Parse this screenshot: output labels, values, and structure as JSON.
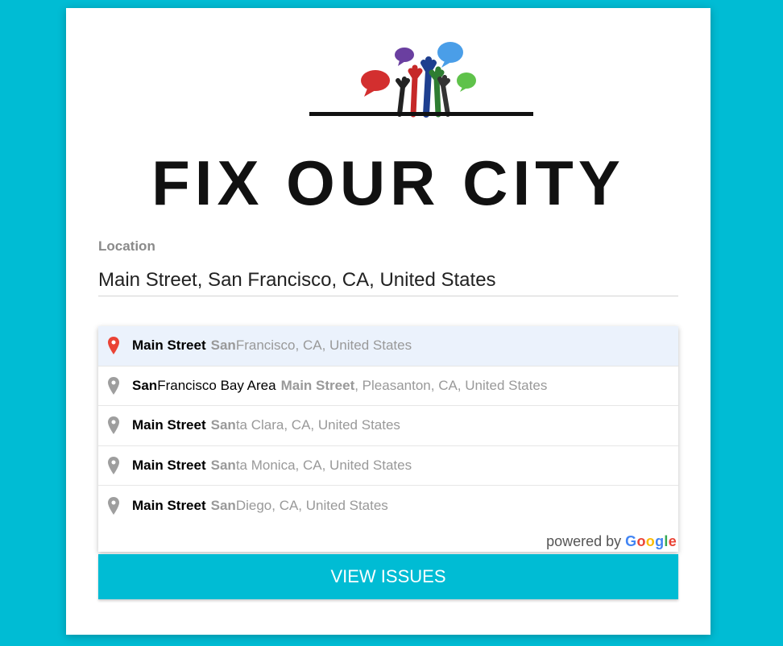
{
  "brand": {
    "title": "FIX OUR CITY",
    "logo_icon": "raised-hands-speech-bubbles-icon"
  },
  "location": {
    "label": "Location",
    "value": "Main Street, San Francisco, CA, United States"
  },
  "suggestions": [
    {
      "main": "Main Street",
      "main_rest": "",
      "secondary_bold": "San",
      "secondary": " Francisco, CA, United States",
      "icon": "map-pin-red-icon"
    },
    {
      "main": "San",
      "main_rest": " Francisco Bay Area",
      "secondary_bold": "Main Street",
      "secondary": ", Pleasanton, CA, United States",
      "icon": "map-pin-gray-icon"
    },
    {
      "main": "Main Street",
      "main_rest": "",
      "secondary_bold": "San",
      "secondary": "ta Clara, CA, United States",
      "icon": "map-pin-gray-icon"
    },
    {
      "main": "Main Street",
      "main_rest": "",
      "secondary_bold": "San",
      "secondary": "ta Monica, CA, United States",
      "icon": "map-pin-gray-icon"
    },
    {
      "main": "Main Street",
      "main_rest": "",
      "secondary_bold": "San",
      "secondary": " Diego, CA, United States",
      "icon": "map-pin-gray-icon"
    }
  ],
  "powered_by": {
    "prefix": "powered by",
    "letters": [
      "G",
      "o",
      "o",
      "g",
      "l",
      "e"
    ]
  },
  "button": {
    "label": "VIEW ISSUES"
  },
  "colors": {
    "background": "#00bcd4",
    "button": "#00bcd4",
    "pin_active": "#ea4335",
    "pin_inactive": "#9e9e9e"
  }
}
